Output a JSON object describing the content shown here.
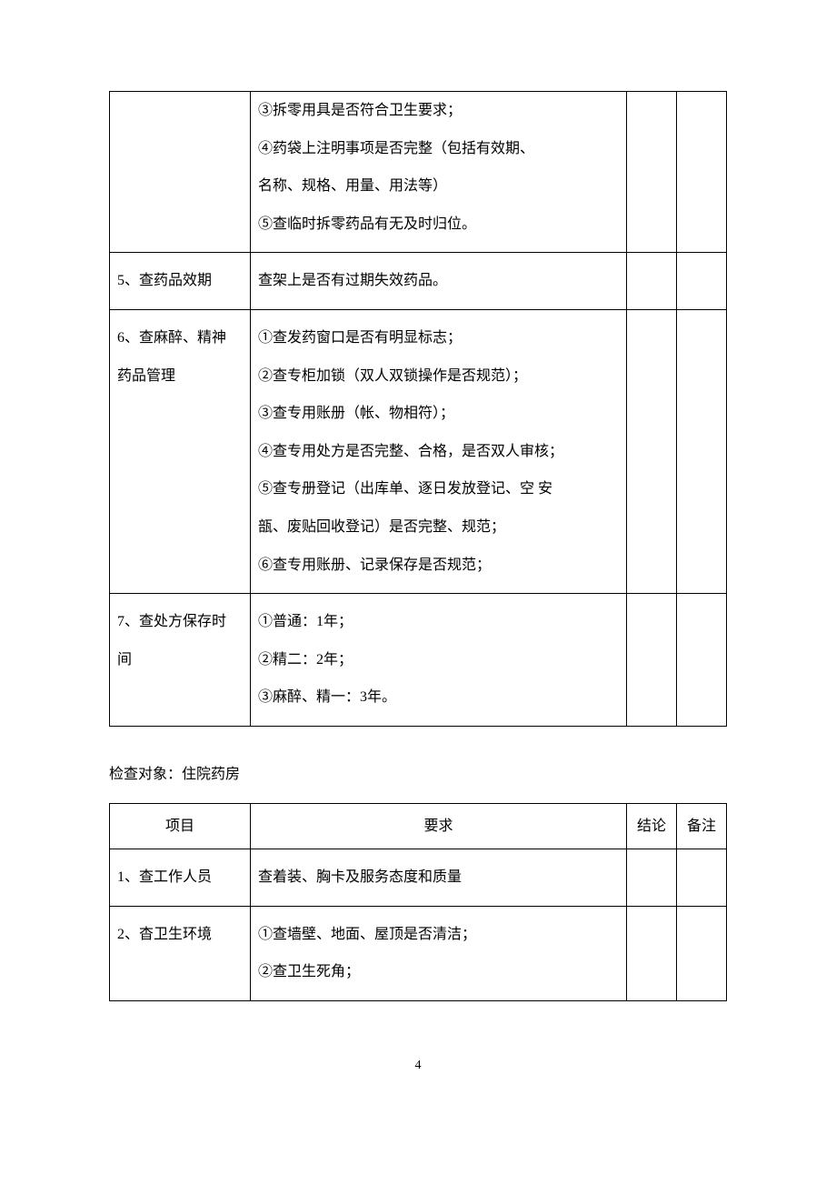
{
  "table1": {
    "rows": [
      {
        "item": "",
        "req": [
          "③拆零用具是否符合卫生要求；",
          "④药袋上注明事项是否完整（包括有效期、",
          "名称、规格、用量、用法等）",
          "⑤查临时拆零药品有无及时归位。"
        ]
      },
      {
        "item": "5、查药品效期",
        "req": [
          "查架上是否有过期失效药品。"
        ]
      },
      {
        "item": "6、查麻醉、精神\n药品管理",
        "req": [
          "①查发药窗口是否有明显标志；",
          "②查专柜加锁（双人双锁操作是否规范）；",
          "③查专用账册（帐、物相符）；",
          "④查专用处方是否完整、合格，是否双人审核；",
          "⑤查专册登记（出库单、逐日发放登记、空 安",
          "瓿、废贴回收登记）是否完整、规范；",
          "⑥查专用账册、记录保存是否规范；"
        ]
      },
      {
        "item": "7、查处方保存时\n间",
        "req": [
          "①普通：1年；",
          "②精二：2年；",
          "③麻醉、精一：3年。"
        ]
      }
    ]
  },
  "section_label": "检查对象：住院药房",
  "table2": {
    "headers": {
      "item": "项目",
      "req": "要求",
      "concl": "结论",
      "note": "备注"
    },
    "rows": [
      {
        "item": "1、查工作人员",
        "req": [
          "查着装、胸卡及服务态度和质量"
        ]
      },
      {
        "item": "2、杳卫生环境",
        "req": [
          "①查墙壁、地面、屋顶是否清洁；",
          "②查卫生死角；"
        ]
      }
    ]
  },
  "page_number": "4"
}
